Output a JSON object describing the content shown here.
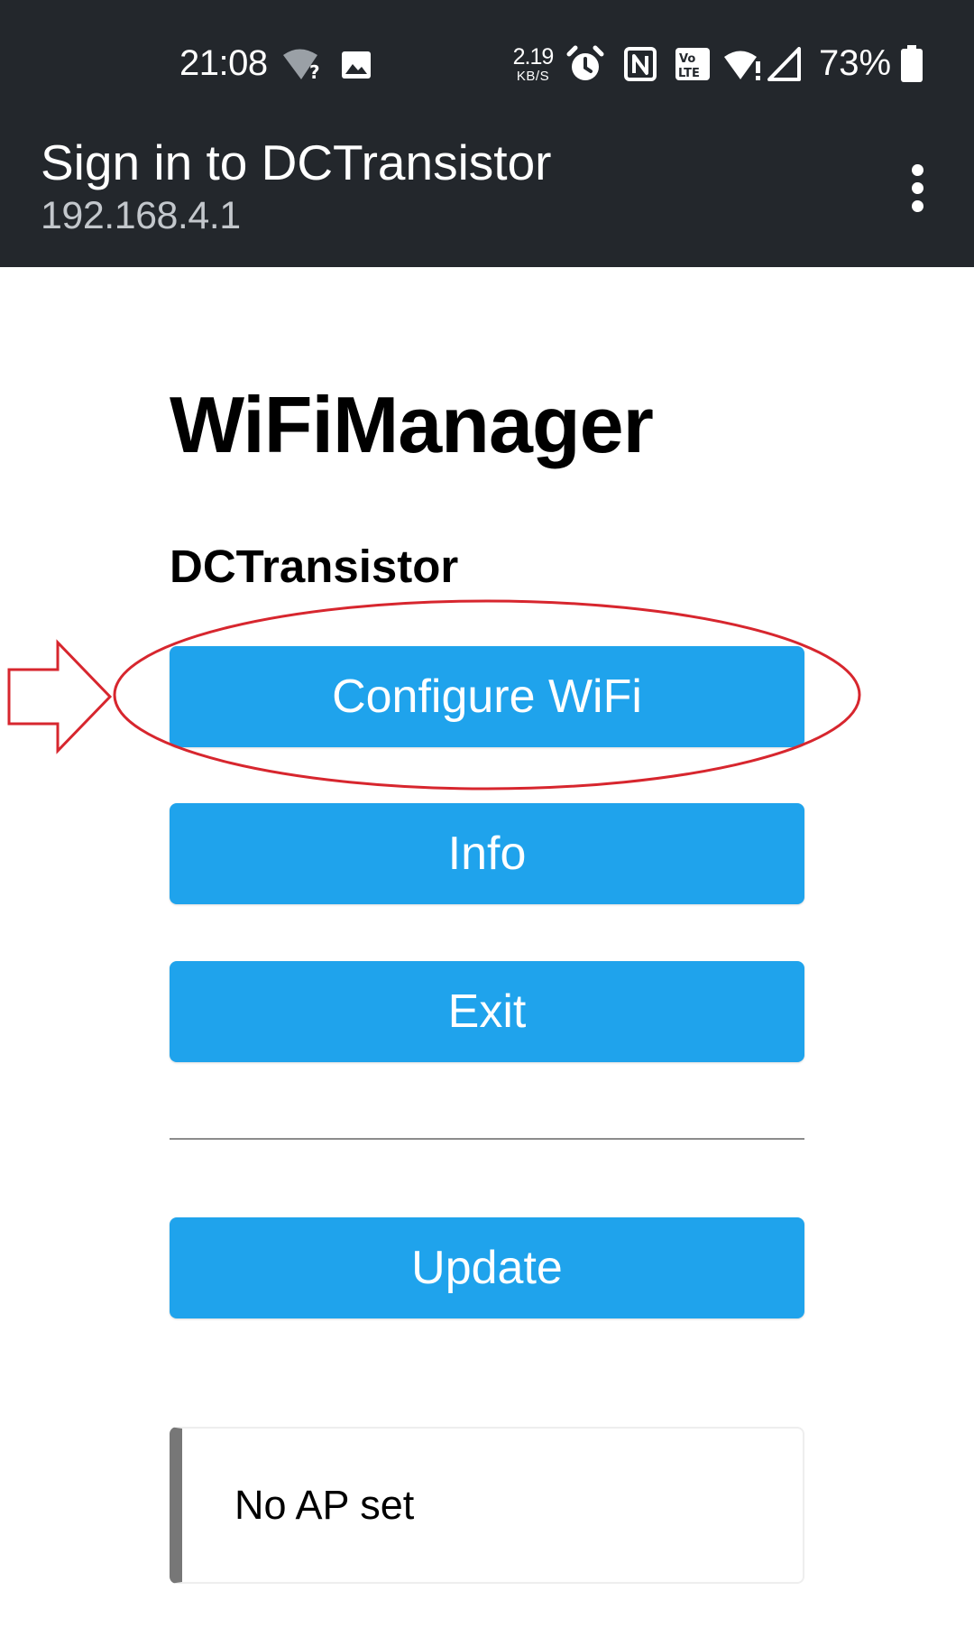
{
  "status_bar": {
    "time": "21:08",
    "net_speed_value": "2.19",
    "net_speed_unit": "KB/S",
    "battery_percent": "73%",
    "icons": [
      "wifi-question-icon",
      "image-notification-icon",
      "alarm-icon",
      "nfc-icon",
      "volte-icon",
      "hotspot-icon",
      "cell-signal-icon",
      "battery-icon"
    ]
  },
  "app_bar": {
    "title": "Sign in to DCTransistor",
    "subtitle": "192.168.4.1",
    "menu_icon": "more-vert-icon"
  },
  "page": {
    "heading": "WiFiManager",
    "device_name": "DCTransistor",
    "buttons": {
      "configure_wifi": "Configure WiFi",
      "info": "Info",
      "exit": "Exit",
      "update": "Update"
    },
    "message": "No AP set"
  },
  "colors": {
    "top_bar": "#23272c",
    "button": "#1fa3ec",
    "annotation": "#d7262e",
    "message_accent": "#777777"
  }
}
